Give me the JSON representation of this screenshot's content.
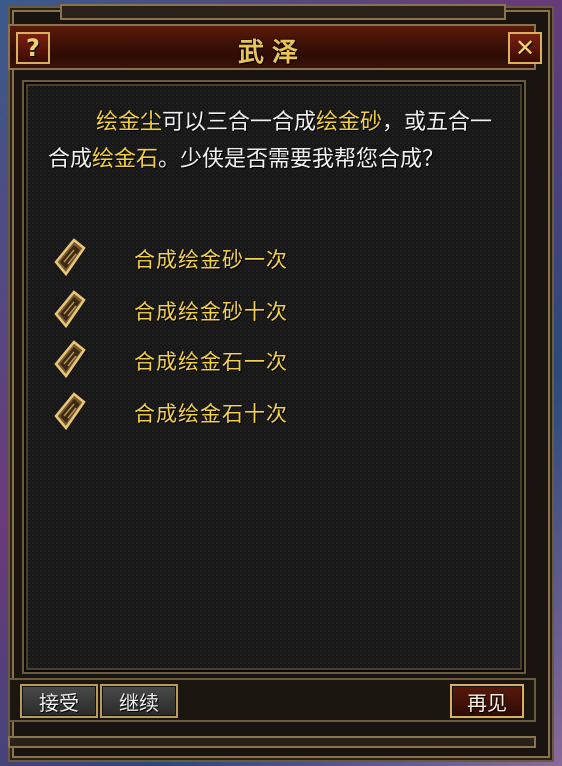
{
  "dialog": {
    "title": "武泽",
    "help_glyph": "?",
    "close_glyph": "✕"
  },
  "message": {
    "p1": "绘金尘",
    "p2": "可以三合一合成",
    "p3": "绘金砂",
    "p4": "，或五合一合成",
    "p5": "绘金石",
    "p6": "。少侠是否需要我帮您合成？"
  },
  "options": [
    {
      "label": "合成绘金砂一次",
      "icon": "scroll-icon"
    },
    {
      "label": "合成绘金砂十次",
      "icon": "scroll-icon"
    },
    {
      "label": "合成绘金石一次",
      "icon": "scroll-icon"
    },
    {
      "label": "合成绘金石十次",
      "icon": "scroll-icon"
    }
  ],
  "buttons": {
    "accept": "接受",
    "continue": "继续",
    "goodbye": "再见"
  },
  "colors": {
    "highlight": "#f2d040",
    "title": "#e8c45a",
    "frame": "#8a7450"
  }
}
